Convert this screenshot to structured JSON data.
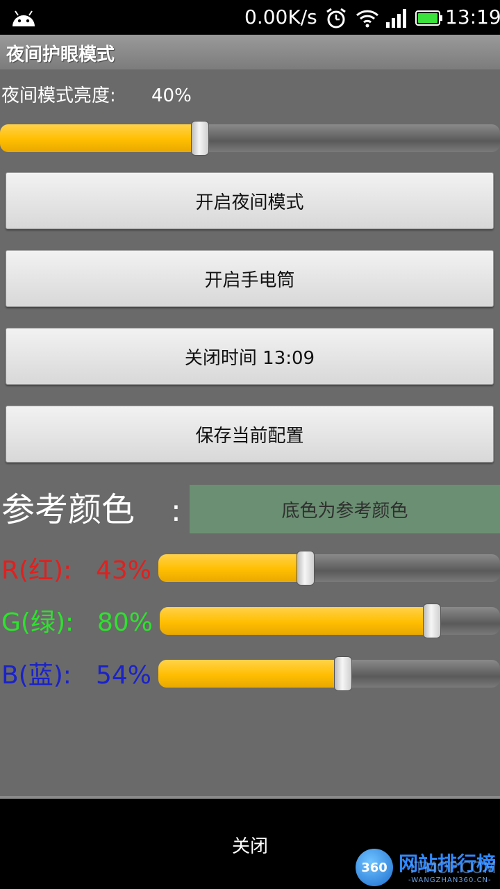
{
  "status_bar": {
    "network_speed": "0.00K/s",
    "time": "13:19",
    "icons": [
      "android-icon",
      "alarm-icon",
      "wifi-icon",
      "signal-icon",
      "battery-icon"
    ]
  },
  "app": {
    "title": "夜间护眼模式"
  },
  "brightness": {
    "label": "夜间模式亮度:",
    "value_text": "40%",
    "value": 0.4
  },
  "buttons": {
    "night_mode": "开启夜间模式",
    "flashlight": "开启手电筒",
    "close_time": "关闭时间 13:09",
    "save_config": "保存当前配置"
  },
  "reference": {
    "label": "参考颜色",
    "colon": ":",
    "box_text": "底色为参考颜色",
    "box_color": "#6b8f72"
  },
  "rgb": [
    {
      "label": "R(红):",
      "value_text": "43%",
      "value": 0.43,
      "color": "#e0201e"
    },
    {
      "label": "G(绿):",
      "value_text": "80%",
      "value": 0.8,
      "color": "#2ee22e"
    },
    {
      "label": "B(蓝):",
      "value_text": "54%",
      "value": 0.54,
      "color": "#1a22c8"
    }
  ],
  "bottom": {
    "close_label": "关闭"
  },
  "watermark": {
    "badge": "360",
    "name": "网站排行榜",
    "overlay": "ITMOP.COM",
    "domain": "-WANGZHAN360.CN-"
  },
  "colors": {
    "accent": "#ffc000",
    "background": "#6a6a6a"
  }
}
